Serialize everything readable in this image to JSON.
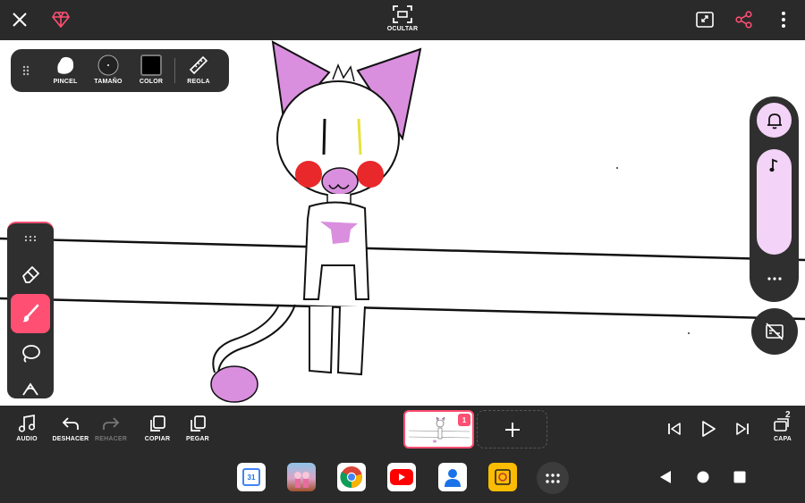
{
  "topbar": {
    "hide_label": "OCULTAR"
  },
  "brush_toolbar": {
    "brush_label": "PINCEL",
    "size_label": "TAMAÑO",
    "color_label": "COLOR",
    "ruler_label": "REGLA",
    "current_color": "#000000"
  },
  "bottom_toolbar": {
    "audio_label": "AUDIO",
    "undo_label": "DESHACER",
    "redo_label": "REHACER",
    "copy_label": "COPIAR",
    "paste_label": "PEGAR",
    "frame_number": "1",
    "layer_label": "CAPA",
    "layer_count": "2"
  },
  "nav": {
    "calendar_day": "31"
  },
  "colors": {
    "accent": "#ff4f73",
    "panel": "#2f2f2f",
    "bar": "#2a2a2a",
    "lilac": "#f3d3f7"
  }
}
